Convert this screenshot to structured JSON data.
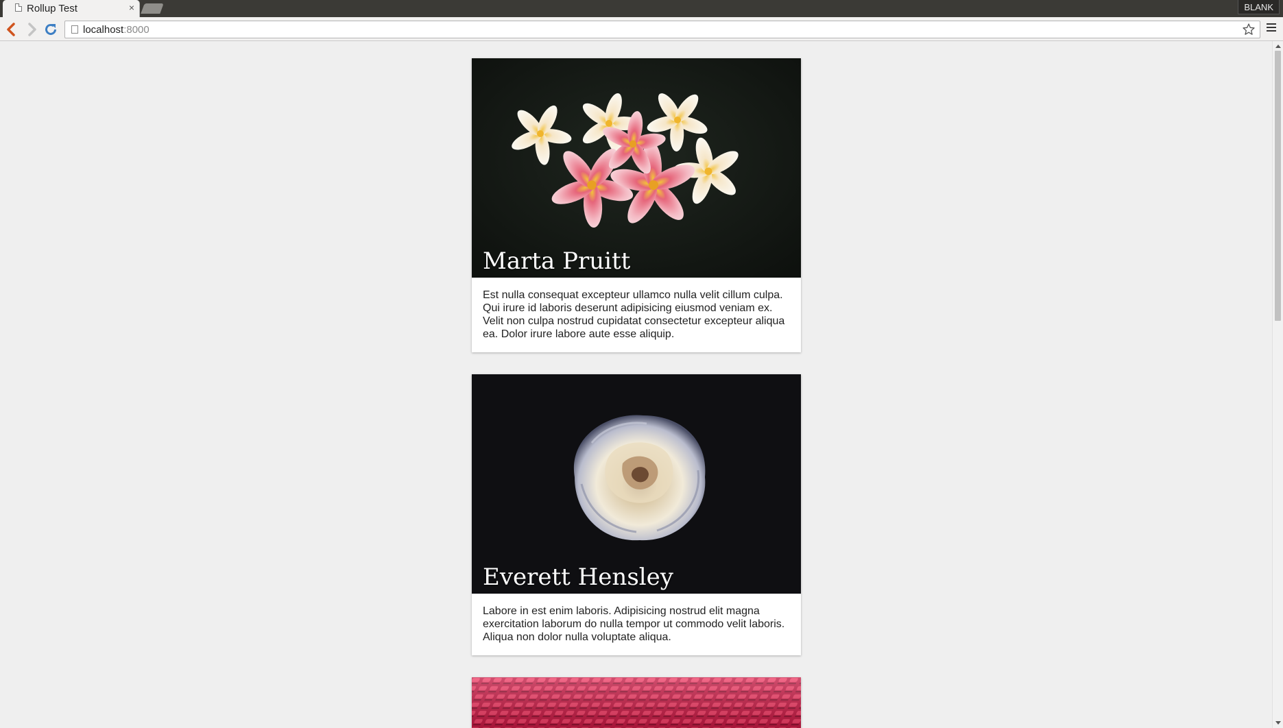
{
  "browser": {
    "tab_title": "Rollup Test",
    "tab_close": "×",
    "profile_badge": "BLANK",
    "url_host": "localhost",
    "url_port": ":8000"
  },
  "cards": [
    {
      "name": "Marta Pruitt",
      "text": "Est nulla consequat excepteur ullamco nulla velit cillum culpa. Qui irure id laboris deserunt adipisicing eiusmod veniam ex. Velit non culpa nostrud cupidatat consectetur excepteur aliqua ea. Dolor irure labore aute esse aliquip.",
      "image": "plumeria-flowers-photo"
    },
    {
      "name": "Everett Hensley",
      "text": "Labore in est enim laboris. Adipisicing nostrud elit magna exercitation laborum do nulla tempor ut commodo velit laboris. Aliqua non dolor nulla voluptate aliqua.",
      "image": "white-rose-photo"
    },
    {
      "image": "red-stadium-seats-photo"
    }
  ],
  "colors": {
    "page_background": "#efefef",
    "card_background": "#ffffff",
    "title_color": "#ffffff",
    "chrome_dark": "#3b3a36"
  }
}
